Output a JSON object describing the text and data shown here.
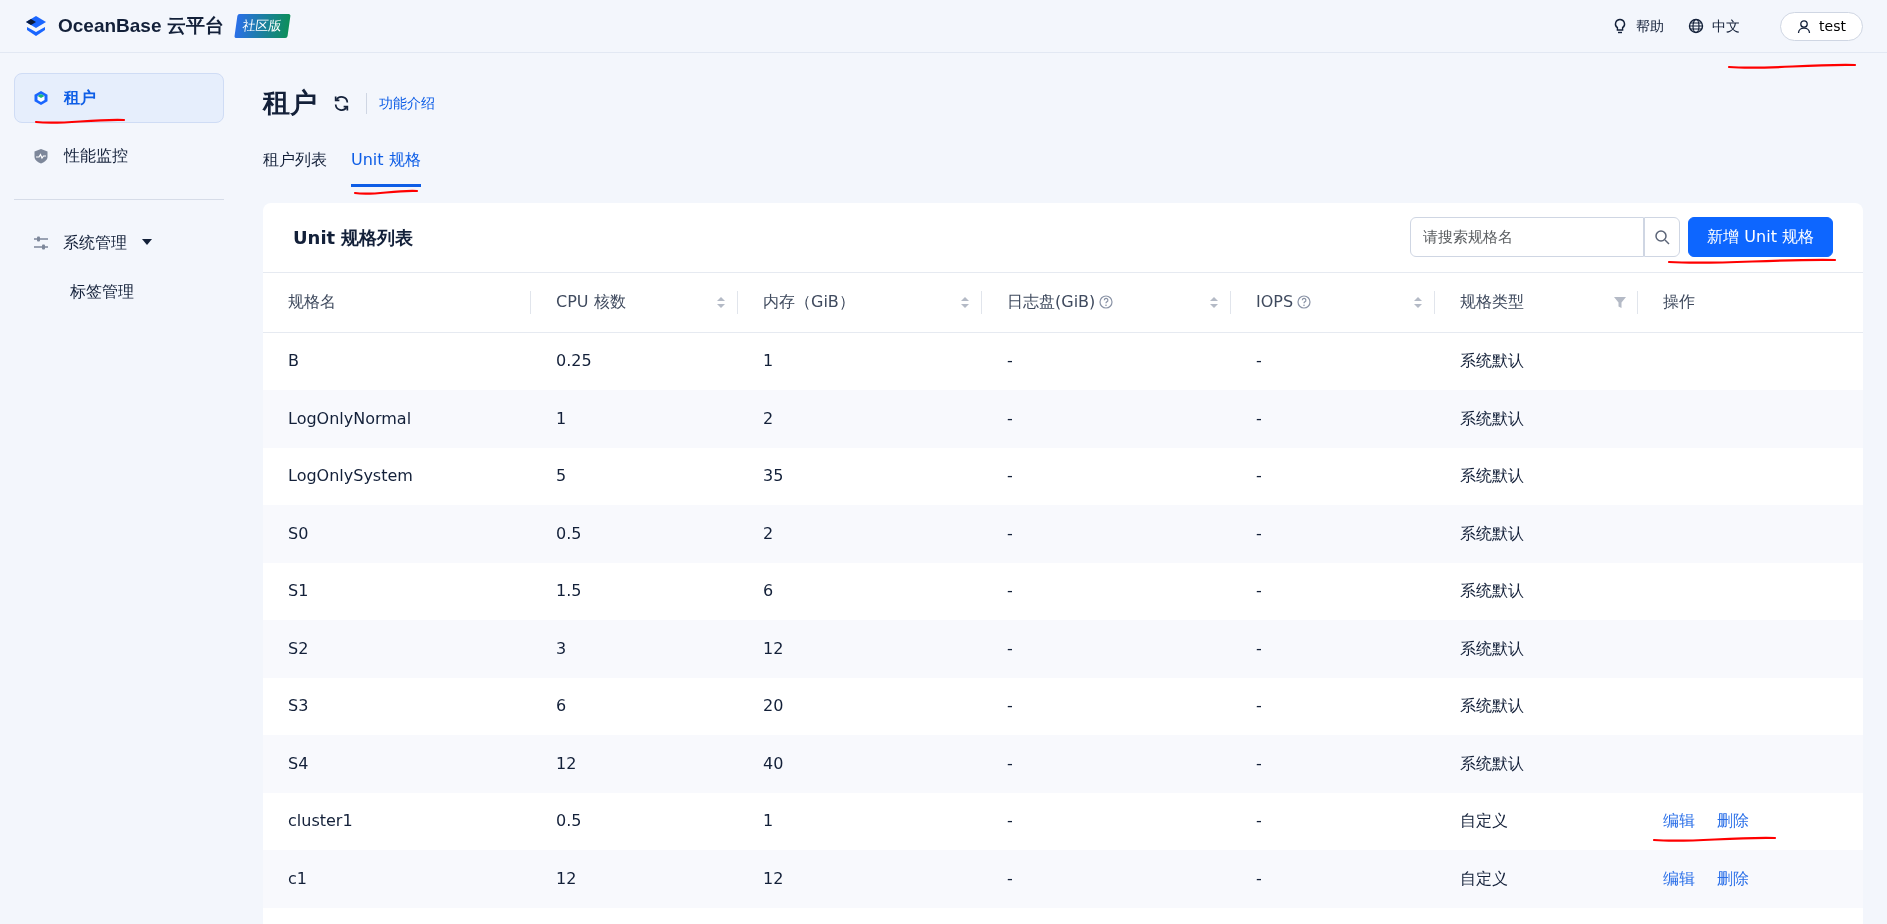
{
  "header": {
    "brand": "OceanBase 云平台",
    "edition_badge": "社区版",
    "help": "帮助",
    "language": "中文",
    "user": "test"
  },
  "sidebar": {
    "items": [
      {
        "label": "租户",
        "selected": true
      },
      {
        "label": "性能监控",
        "selected": false
      }
    ],
    "groups": [
      {
        "label": "系统管理",
        "expanded": true,
        "children": [
          {
            "label": "标签管理",
            "selected": false
          }
        ]
      }
    ]
  },
  "page": {
    "title": "租户",
    "intro_link": "功能介绍",
    "tabs": [
      {
        "label": "租户列表",
        "selected": false
      },
      {
        "label": "Unit 规格",
        "selected": true
      }
    ]
  },
  "panel": {
    "title": "Unit 规格列表",
    "search": {
      "placeholder": "请搜索规格名"
    },
    "add_button": "新增 Unit 规格"
  },
  "table": {
    "columns": [
      {
        "label": "规格名"
      },
      {
        "label": "CPU 核数",
        "sortable": true
      },
      {
        "label": "内存（GiB）",
        "sortable": true
      },
      {
        "label": "日志盘(GiB)",
        "help": true,
        "sortable": true
      },
      {
        "label": "IOPS",
        "help": true,
        "sortable": true
      },
      {
        "label": "规格类型",
        "filterable": true
      },
      {
        "label": "操作"
      }
    ],
    "rows": [
      {
        "cells": [
          "B",
          "0.25",
          "1",
          "-",
          "-",
          "系统默认"
        ]
      },
      {
        "cells": [
          "LogOnlyNormal",
          "1",
          "2",
          "-",
          "-",
          "系统默认"
        ]
      },
      {
        "cells": [
          "LogOnlySystem",
          "5",
          "35",
          "-",
          "-",
          "系统默认"
        ]
      },
      {
        "cells": [
          "S0",
          "0.5",
          "2",
          "-",
          "-",
          "系统默认"
        ]
      },
      {
        "cells": [
          "S1",
          "1.5",
          "6",
          "-",
          "-",
          "系统默认"
        ]
      },
      {
        "cells": [
          "S2",
          "3",
          "12",
          "-",
          "-",
          "系统默认"
        ]
      },
      {
        "cells": [
          "S3",
          "6",
          "20",
          "-",
          "-",
          "系统默认"
        ]
      },
      {
        "cells": [
          "S4",
          "12",
          "40",
          "-",
          "-",
          "系统默认"
        ]
      },
      {
        "cells": [
          "cluster1",
          "0.5",
          "1",
          "-",
          "-",
          "自定义"
        ],
        "actions": [
          "编辑",
          "删除"
        ]
      },
      {
        "cells": [
          "c1",
          "12",
          "12",
          "-",
          "-",
          "自定义"
        ],
        "actions": [
          "编辑",
          "删除"
        ]
      }
    ]
  }
}
